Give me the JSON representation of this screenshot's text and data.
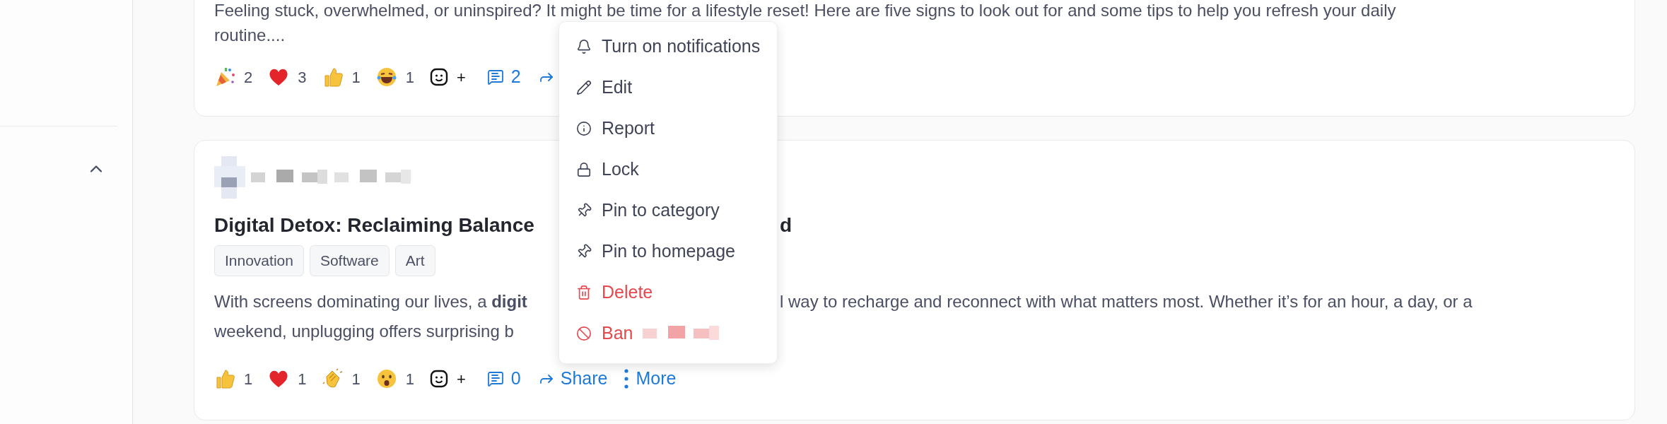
{
  "sidebar": {
    "section_expanded": true
  },
  "posts": [
    {
      "body_lines": [
        "Feeling stuck, overwhelmed, or uninspired? It might be time for a lifestyle reset! Here are five signs to look out for and some tips to help you refresh your daily",
        "routine...."
      ],
      "reactions": [
        {
          "kind": "party",
          "count": "2"
        },
        {
          "kind": "heart",
          "count": "3"
        },
        {
          "kind": "thumbs_up",
          "count": "1"
        },
        {
          "kind": "laugh",
          "count": "1"
        }
      ],
      "add_reaction": "+",
      "comments": "2"
    },
    {
      "title_parts": [
        "Digital Detox: Reclaiming Balance",
        "d"
      ],
      "tags": [
        "Innovation",
        "Software",
        "Art"
      ],
      "body_parts": [
        [
          "With screens dominating our lives, a **digit**",
          "l way to recharge and reconnect with what matters most. Whether it’s for an hour, a day, or a"
        ],
        [
          "weekend, unplugging offers surprising b"
        ]
      ],
      "reactions": [
        {
          "kind": "thumbs_up",
          "count": "1"
        },
        {
          "kind": "heart",
          "count": "1"
        },
        {
          "kind": "clap",
          "count": "1"
        },
        {
          "kind": "surprised",
          "count": "1"
        }
      ],
      "add_reaction": "+",
      "comments": "0",
      "share": "Share",
      "more": "More"
    }
  ],
  "menu": [
    {
      "kind": "bell",
      "label": "Turn on notifications",
      "danger": false
    },
    {
      "kind": "edit",
      "label": "Edit",
      "danger": false
    },
    {
      "kind": "info",
      "label": "Report",
      "danger": false
    },
    {
      "kind": "lock",
      "label": "Lock",
      "danger": false
    },
    {
      "kind": "pin",
      "label": "Pin to category",
      "danger": false
    },
    {
      "kind": "pin",
      "label": "Pin to homepage",
      "danger": false
    },
    {
      "kind": "trash",
      "label": "Delete",
      "danger": true
    },
    {
      "kind": "ban",
      "label": "Ban",
      "danger": true,
      "redacted_name": true
    }
  ]
}
